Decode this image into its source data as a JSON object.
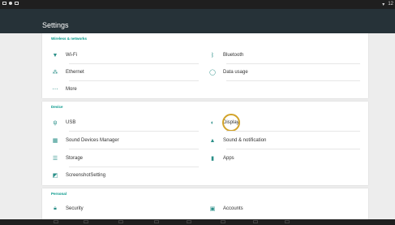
{
  "status": {
    "time": "12"
  },
  "appbar": {
    "title": "Settings"
  },
  "sections": {
    "wireless": {
      "title": "Wireless & networks",
      "items": [
        {
          "label": "Wi-Fi",
          "icon": "wifi-icon"
        },
        {
          "label": "Bluetooth",
          "icon": "bluetooth-icon"
        },
        {
          "label": "Ethernet",
          "icon": "ethernet-icon"
        },
        {
          "label": "Data usage",
          "icon": "data-usage-icon"
        },
        {
          "label": "More",
          "icon": "more-icon"
        }
      ]
    },
    "device": {
      "title": "Device",
      "items": [
        {
          "label": "USB",
          "icon": "usb-icon"
        },
        {
          "label": "Display",
          "icon": "display-icon"
        },
        {
          "label": "Sound Devices Manager",
          "icon": "sound-devices-icon"
        },
        {
          "label": "Sound & notification",
          "icon": "bell-icon"
        },
        {
          "label": "Storage",
          "icon": "storage-icon"
        },
        {
          "label": "Apps",
          "icon": "android-icon"
        },
        {
          "label": "ScreenshotSetting",
          "icon": "screenshot-icon"
        }
      ]
    },
    "personal": {
      "title": "Personal",
      "items": [
        {
          "label": "Security",
          "icon": "lock-icon"
        },
        {
          "label": "Accounts",
          "icon": "account-icon"
        }
      ]
    }
  },
  "colors": {
    "accent": "#009688",
    "appbar": "#263238",
    "highlight": "#d2a32a"
  }
}
